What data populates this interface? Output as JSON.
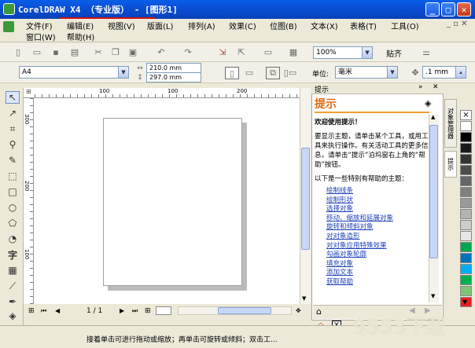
{
  "window": {
    "title": "CorelDRAW X4 （专业版） - [图形1]"
  },
  "menu": {
    "row1": [
      "文件(F)",
      "编辑(E)",
      "视图(V)",
      "版面(L)",
      "排列(A)",
      "效果(C)",
      "位图(B)",
      "文本(X)",
      "表格(T)",
      "工具(O)"
    ],
    "row2": [
      "窗口(W)",
      "帮助(H)"
    ]
  },
  "standard_toolbar": {
    "zoom": "100%",
    "snap": "贴齐"
  },
  "property_bar": {
    "paper": "A4",
    "width": "210.0 mm",
    "height": "297.0 mm",
    "units_label": "单位:",
    "units": "毫米",
    "nudge": ".1 mm"
  },
  "ruler": {
    "h_labels": [
      "100",
      "100",
      "200"
    ],
    "v_labels": [
      "300",
      "200",
      "100"
    ]
  },
  "page_nav": {
    "page_label": "1 / 1"
  },
  "docker": {
    "panel_label": "提示",
    "title": "提示",
    "welcome": "欢迎使用提示！",
    "para1": "要显示主题，请单击某个工具，或用工具来执行操作。有关活动工具的更多信息，请单击“提示”泊坞窗右上角的“帮助”按钮。",
    "para2": "以下是一些特别有帮助的主题：",
    "links": [
      "绘制线条",
      "绘制形状",
      "选择对象",
      "移动、缩放和延展对象",
      "旋转和倾斜对象",
      "对对象造形",
      "对对象应用特殊效果",
      "勾画对象轮廓",
      "填充对象",
      "添加文本",
      "获取帮助"
    ],
    "side_tabs": [
      "对象管理器",
      "提示"
    ]
  },
  "palette": {
    "colors": [
      "#ffffff",
      "#000000",
      "#1a1a1a",
      "#333333",
      "#4d4d4d",
      "#666666",
      "#808080",
      "#999999",
      "#b3b3b3",
      "#cccccc",
      "#e6e6e6",
      "#00a651",
      "#0072bc",
      "#00aeef",
      "#00b050",
      "#7cc576",
      "#ed1c24"
    ]
  },
  "status": {
    "hint": "接着单击可进行拖动或缩放；再单击可旋转或倾斜；双击工..."
  },
  "watermark": "9553下载"
}
